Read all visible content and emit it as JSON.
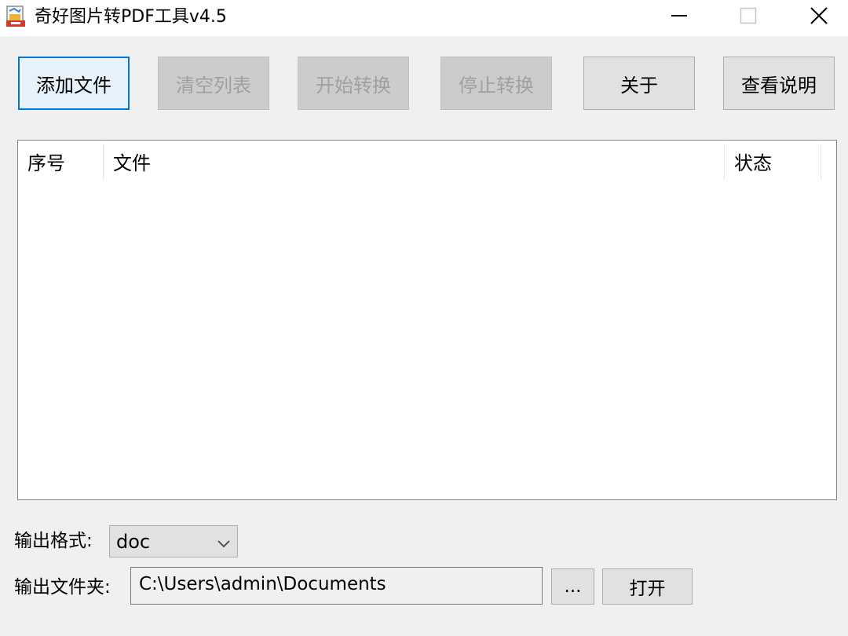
{
  "window": {
    "title": "奇好图片转PDF工具v4.5"
  },
  "toolbar": {
    "add_label": "添加文件",
    "clear_label": "清空列表",
    "start_label": "开始转换",
    "stop_label": "停止转换",
    "about_label": "关于",
    "help_label": "查看说明"
  },
  "list": {
    "columns": [
      "序号",
      "文件",
      "状态"
    ],
    "rows": []
  },
  "output": {
    "format_label": "输出格式:",
    "format_value": "doc",
    "folder_label": "输出文件夹:",
    "folder_value": "C:\\Users\\admin\\Documents",
    "browse_label": "...",
    "open_label": "打开"
  },
  "colors": {
    "window_bg": "#f0f0f0",
    "accent": "#0078d7",
    "disabled_text": "#a0a0a0"
  },
  "icons": {
    "app": "image-to-pdf-icon",
    "minimize": "minimize-icon",
    "maximize": "maximize-icon",
    "close": "close-icon",
    "dropdown": "chevron-down-icon"
  }
}
